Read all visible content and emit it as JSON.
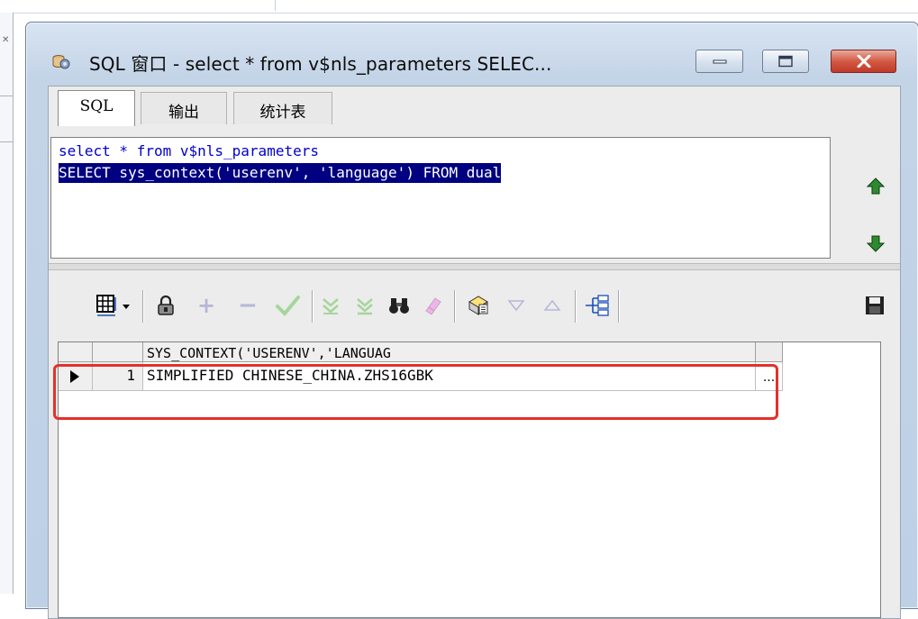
{
  "window": {
    "title": "SQL 窗口 - select * from v$nls_parameters SELEC...",
    "icon": "sql-window-icon"
  },
  "tabs": [
    {
      "label": "SQL",
      "active": true
    },
    {
      "label": "输出",
      "active": false
    },
    {
      "label": "统计表",
      "active": false
    }
  ],
  "editor": {
    "lines": [
      "select * from v$nls_parameters",
      "SELECT sys_context('userenv', 'language') FROM dual"
    ],
    "selected_line": 2
  },
  "grid": {
    "columns": [
      "SYS_CONTEXT('USERENV','LANGUAG"
    ],
    "rows": [
      {
        "num": "1",
        "value": "SIMPLIFIED CHINESE_CHINA.ZHS16GBK",
        "ellipsis": "..."
      }
    ]
  },
  "colors": {
    "selection_bg": "#000080",
    "highlight_box": "#e4302b",
    "close_button": "#c0392b"
  }
}
